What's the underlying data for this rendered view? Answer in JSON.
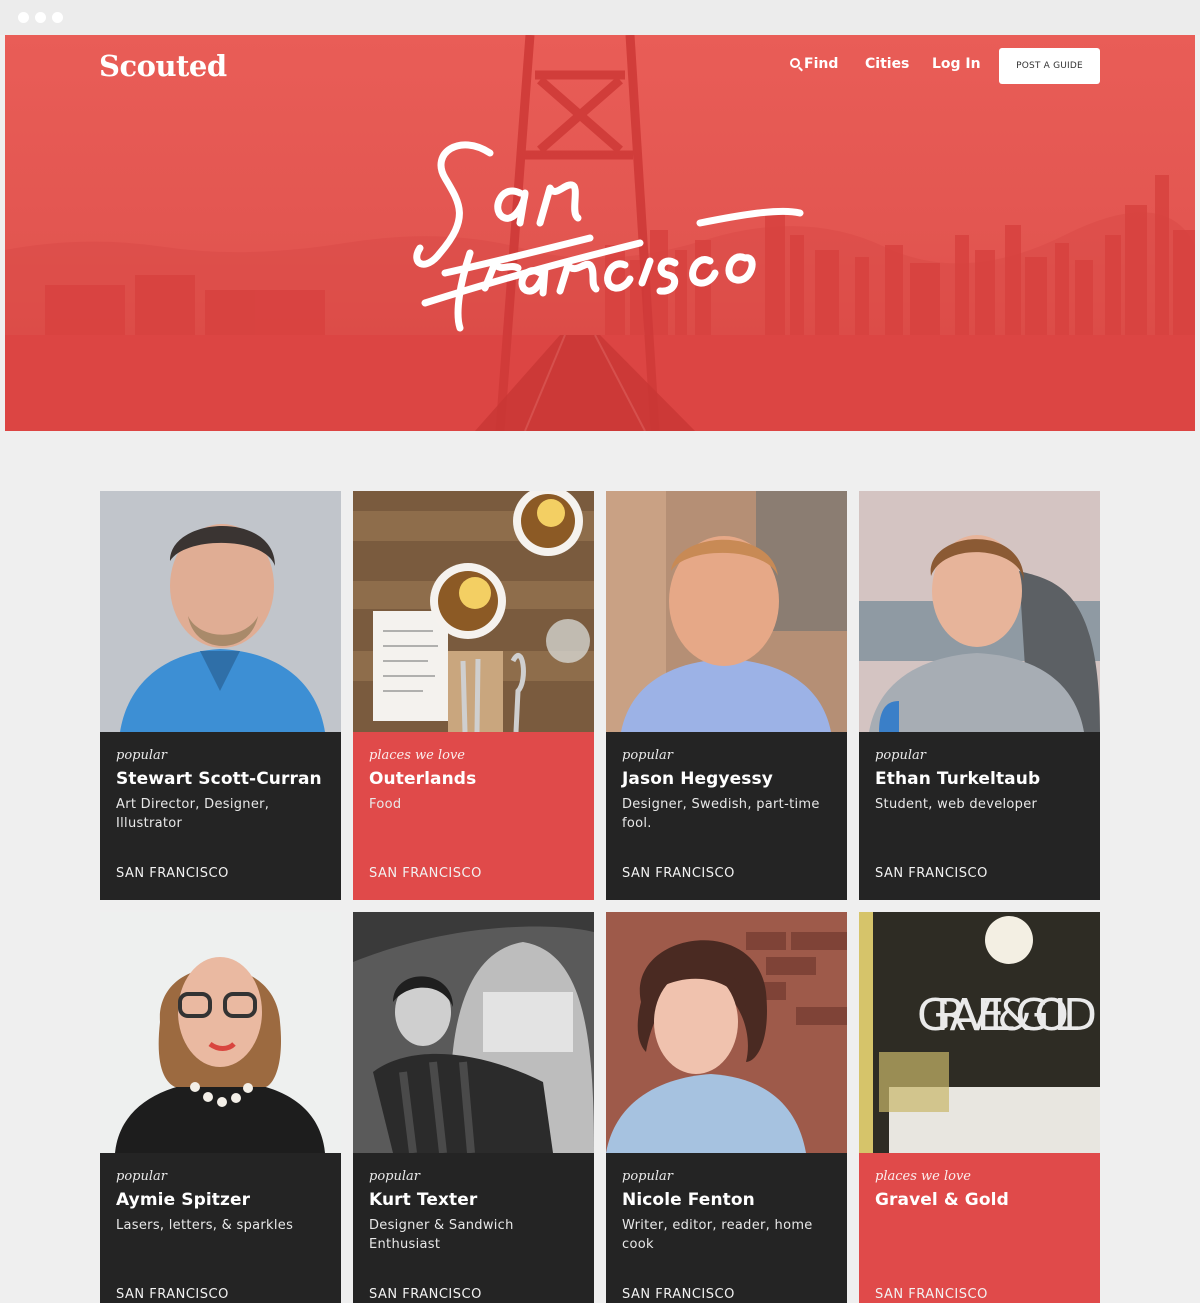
{
  "header": {
    "logo": "Scouted",
    "nav": {
      "find": "Find",
      "cities": "Cities",
      "login": "Log In"
    },
    "post_button": "POST A GUIDE"
  },
  "hero": {
    "city_script": "San Francisco"
  },
  "colors": {
    "brand_red": "#e0504c",
    "card_dark": "#242424",
    "card_red": "#e04a4a"
  },
  "cards": [
    {
      "tag": "popular",
      "name": "Stewart Scott-Curran",
      "desc": "Art Director, Designer, Illustrator",
      "city": "SAN FRANCISCO"
    },
    {
      "tag": "places we love",
      "name": "Outerlands",
      "desc": "Food",
      "city": "SAN FRANCISCO"
    },
    {
      "tag": "popular",
      "name": "Jason Hegyessy",
      "desc": "Designer, Swedish, part-time fool.",
      "city": "SAN FRANCISCO"
    },
    {
      "tag": "popular",
      "name": "Ethan Turkeltaub",
      "desc": "Student, web developer",
      "city": "SAN FRANCISCO"
    },
    {
      "tag": "popular",
      "name": "Aymie Spitzer",
      "desc": "Lasers, letters, & sparkles",
      "city": "SAN FRANCISCO"
    },
    {
      "tag": "popular",
      "name": "Kurt Texter",
      "desc": "Designer & Sandwich Enthusiast",
      "city": "SAN FRANCISCO"
    },
    {
      "tag": "popular",
      "name": "Nicole Fenton",
      "desc": "Writer, editor, reader, home cook",
      "city": "SAN FRANCISCO"
    },
    {
      "tag": "places we love",
      "name": "Gravel & Gold",
      "desc": "",
      "city": "SAN FRANCISCO",
      "sign_text": "GRAVEL & GOLD"
    }
  ]
}
